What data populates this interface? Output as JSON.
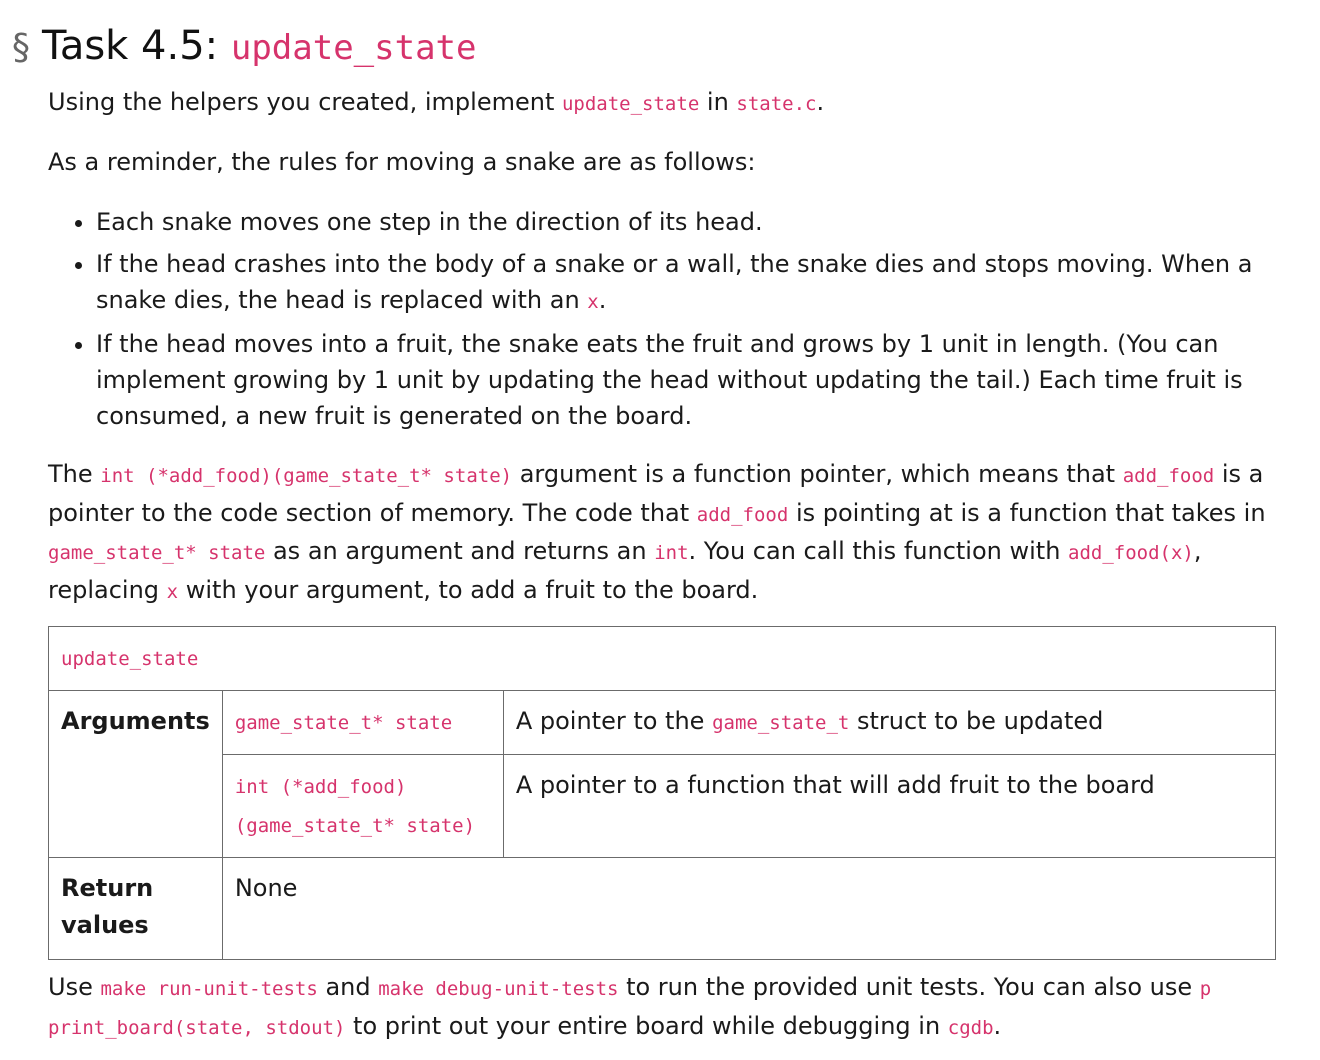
{
  "heading": {
    "symbol": "§",
    "prefix": "Task 4.5: ",
    "code": "update_state"
  },
  "intro": {
    "t1": "Using the helpers you created, implement ",
    "c1": "update_state",
    "t2": " in ",
    "c2": "state.c",
    "t3": "."
  },
  "reminder": "As a reminder, the rules for moving a snake are as follows:",
  "rules": {
    "r1": "Each snake moves one step in the direction of its head.",
    "r2_text": "If the head crashes into the body of a snake or a wall, the snake dies and stops moving. When a snake dies, the head is replaced with an ",
    "r2_code": "x",
    "r2_end": ".",
    "r3": "If the head moves into a fruit, the snake eats the fruit and grows by 1 unit in length. (You can implement growing by 1 unit by updating the head without updating the tail.) Each time fruit is consumed, a new fruit is generated on the board."
  },
  "fp": {
    "t1": "The ",
    "c1": "int (*add_food)(game_state_t* state)",
    "t2": " argument is a function pointer, which means that ",
    "c2": "add_food",
    "t3": " is a pointer to the code section of memory. The code that ",
    "c3": "add_food",
    "t4": " is pointing at is a function that takes in ",
    "c4": "game_state_t* state",
    "t5": " as an argument and returns an ",
    "c5": "int",
    "t6": ". You can call this function with ",
    "c6": "add_food(x)",
    "t7": ", replacing ",
    "c7": "x",
    "t8": " with your argument, to add a fruit to the board."
  },
  "table": {
    "title": "update_state",
    "arguments_label": "Arguments",
    "arg1_code": "game_state_t* state",
    "arg1_desc_t1": "A pointer to the ",
    "arg1_desc_code": "game_state_t",
    "arg1_desc_t2": " struct to be updated",
    "arg2_code_line1": "int (*add_food)",
    "arg2_code_line2": "(game_state_t* state)",
    "arg2_desc": "A pointer to a function that will add fruit to the board",
    "return_label": "Return values",
    "return_value": "None"
  },
  "footer": {
    "t1": "Use ",
    "c1": "make run-unit-tests",
    "t2": " and ",
    "c2": "make debug-unit-tests",
    "t3": " to run the provided unit tests. You can also use ",
    "c3": "p print_board(state, stdout)",
    "t4": " to print out your entire board while debugging in ",
    "c4": "cgdb",
    "t5": "."
  },
  "colors": {
    "code": "#d6336c",
    "text": "#1a1a1a",
    "border": "#6b6b6b"
  }
}
